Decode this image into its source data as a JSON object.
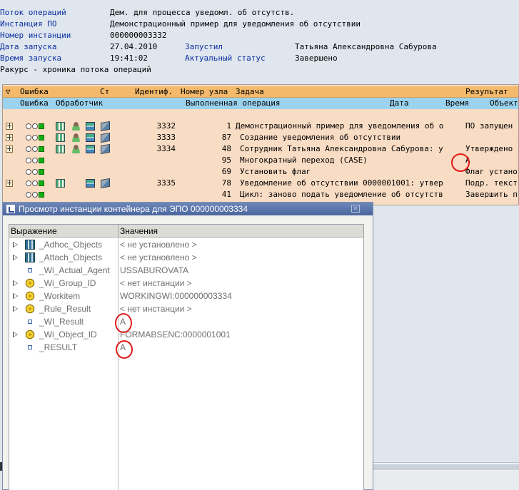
{
  "header": {
    "rows": [
      {
        "label": "Поток операций",
        "value": "Дем. для процесса уведомл. об отсутств."
      },
      {
        "label": "Инстанция ПО",
        "value": "Демонстрационный пример для уведомления об отсутствии"
      },
      {
        "label": "Номер инстанции",
        "value": "000000003332"
      },
      {
        "label": "Дата запуска",
        "value": "27.04.2010",
        "label2": "Запустил",
        "value2": "Татьяна Александровна Сабурова"
      },
      {
        "label": "Время запуска",
        "value": "19:41:02",
        "label2": "Актуальный статус",
        "value2": "Завершено"
      }
    ],
    "view": "Ракурс - хроника потока операций"
  },
  "log_table": {
    "header1": {
      "error": "Ошибка",
      "status": "Ст",
      "ident": "Идентиф.",
      "node": "Номер узла",
      "task": "Задача",
      "result": "Результат"
    },
    "header2": {
      "error": "Ошибка",
      "handler": "Обработчик",
      "operation": "Выполненная операция",
      "date": "Дата",
      "time": "Время",
      "object": "Объект"
    },
    "rows": [
      {
        "expand": true,
        "lights": true,
        "icons": [
          "tree",
          "person",
          "flow",
          "cube"
        ],
        "id": "3332",
        "node": "1",
        "text": "Демонстрационный пример для уведомления об о",
        "result": "ПО запущен"
      },
      {
        "expand": true,
        "lights": true,
        "icons": [
          "tree",
          "person",
          "flow",
          "cube"
        ],
        "id": "3333",
        "node": "87",
        "text": "Создание уведомления об отсутствии",
        "result": ""
      },
      {
        "expand": true,
        "lights": true,
        "icons": [
          "tree",
          "person",
          "flow",
          "cube"
        ],
        "id": "3334",
        "node": "48",
        "text": "Сотрудник Татьяна Александровна Сабурова: у",
        "result": "Утверждено"
      },
      {
        "expand": false,
        "lights": true,
        "icons": [],
        "id": "",
        "node": "95",
        "text": "Многократный переход (CASE)",
        "result": "A"
      },
      {
        "expand": false,
        "lights": true,
        "icons": [],
        "id": "",
        "node": "69",
        "text": "Установить флаг",
        "result": "Флаг устано"
      },
      {
        "expand": true,
        "lights": true,
        "icons": [
          "tree",
          "flow",
          "cube"
        ],
        "id": "3335",
        "node": "78",
        "text": "Уведомление об отсутствии 0000001001: утвер",
        "result": "Подр. текст"
      },
      {
        "expand": false,
        "lights": true,
        "icons": [],
        "id": "",
        "node": "41",
        "text": "Цикл: заново подать уведомление об отсутств",
        "result": "Завершить п"
      }
    ]
  },
  "dialog": {
    "title": "Просмотр инстанции контейнера для ЭПО 000000003334",
    "col_expression": "Выражение",
    "col_values": "Значения",
    "rows": [
      {
        "expandable": true,
        "icon": "table-icon",
        "name": "_Adhoc_Objects",
        "value": "< не установлено >"
      },
      {
        "expandable": true,
        "icon": "table-icon",
        "name": "_Attach_Objects",
        "value": "< не установлено >"
      },
      {
        "expandable": false,
        "icon": "element-icon",
        "name": "_Wi_Actual_Agent",
        "value": "USSABUROVATA"
      },
      {
        "expandable": true,
        "icon": "object-icon",
        "name": "_Wi_Group_ID",
        "value": "< нет инстанции >"
      },
      {
        "expandable": true,
        "icon": "object-icon",
        "name": "_Workitem",
        "value": "WORKINGWI:000000003334"
      },
      {
        "expandable": true,
        "icon": "object-icon",
        "name": "_Rule_Result",
        "value": "< нет инстанции >"
      },
      {
        "expandable": false,
        "icon": "element-icon",
        "name": "_WI_Result",
        "value": "A"
      },
      {
        "expandable": true,
        "icon": "object-icon",
        "name": "_Wi_Object_ID",
        "value": "FORMABSENC:0000001001"
      },
      {
        "expandable": false,
        "icon": "element-icon",
        "name": "_RESULT",
        "value": "A"
      }
    ]
  },
  "colors": {
    "header_label": "#0b2ea0",
    "table_bg": "#f9dcc4",
    "table_header_orange": "#f4b96b",
    "table_header_blue": "#9bd3ef",
    "dialog_title": "#4b669e",
    "annotation_red": "#e21a1a"
  }
}
